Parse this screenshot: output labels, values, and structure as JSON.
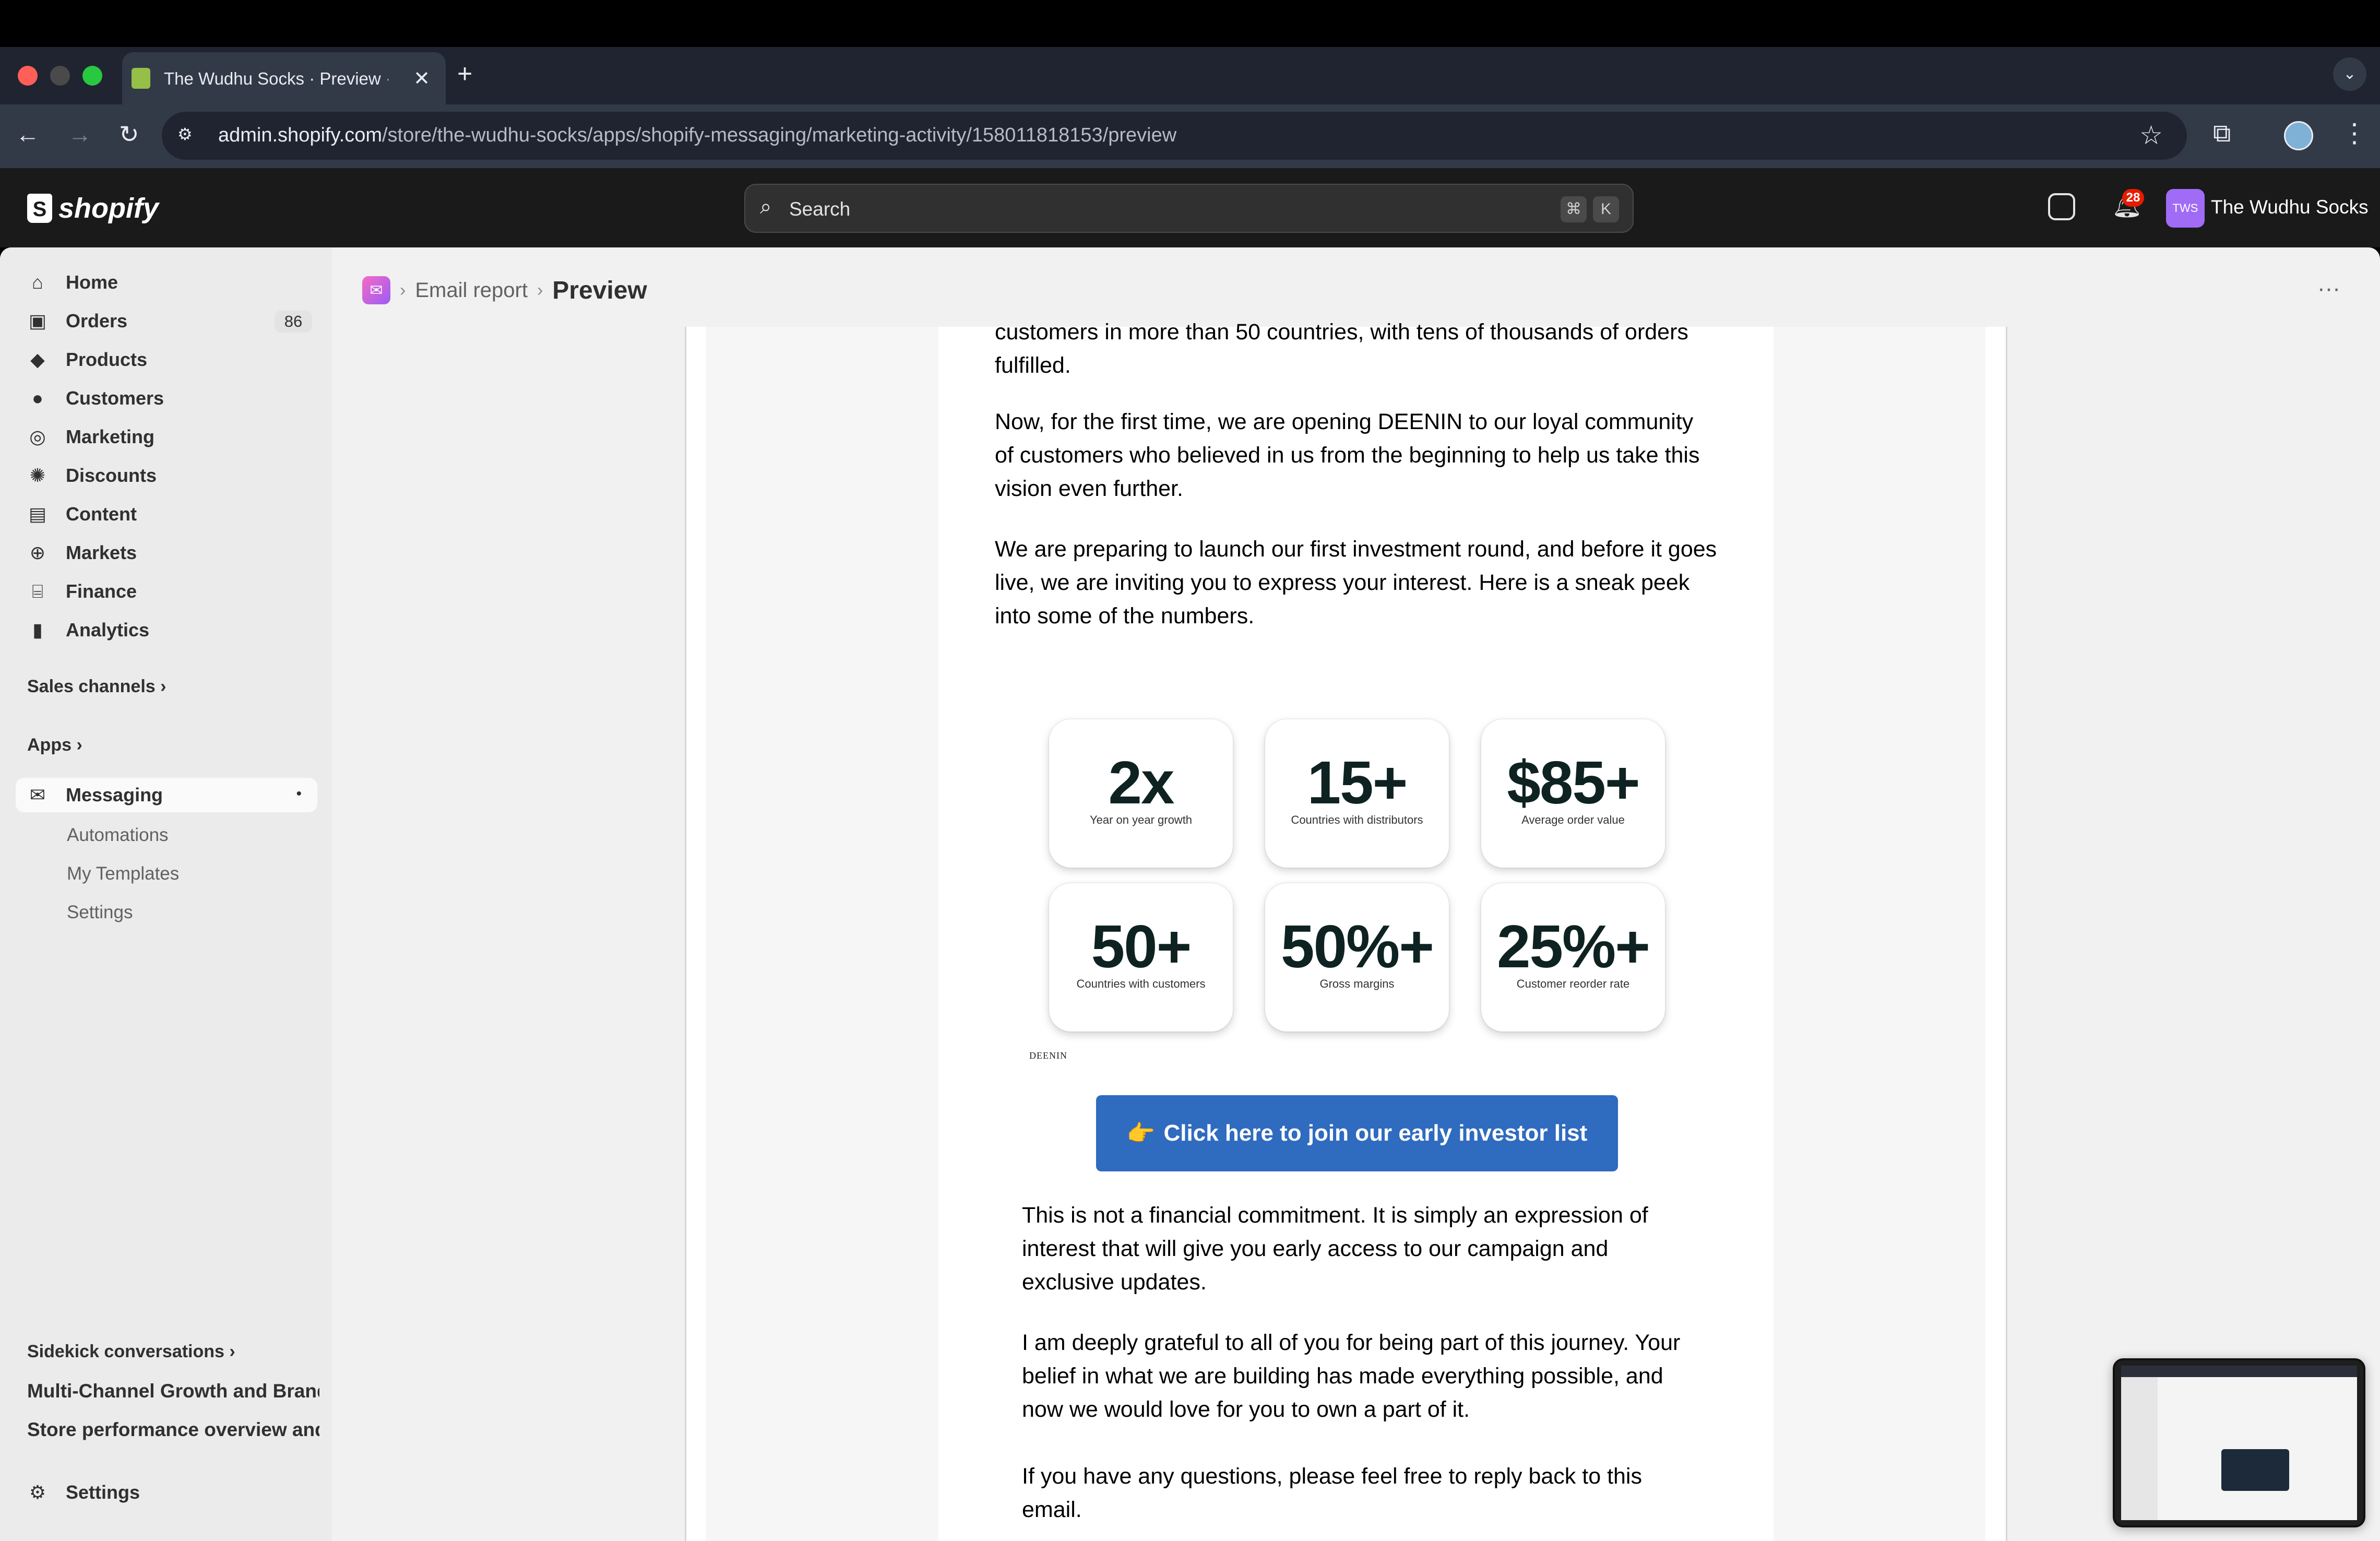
{
  "browser": {
    "tab_title": "The Wudhu Socks · Preview · Shopify",
    "tab_close": "✕",
    "new_tab": "+",
    "url_host": "admin.shopify.com",
    "url_path": "/store/the-wudhu-socks/apps/shopify-messaging/marketing-activity/158011818153/preview",
    "traffic_colors": [
      "#ff5f57",
      "#4a4a4a",
      "#28c840"
    ]
  },
  "topbar": {
    "logo_text": "shopify",
    "search_placeholder": "Search",
    "shortcut_keys": [
      "⌘",
      "K"
    ],
    "notifications_count": "28",
    "store_initials": "TWS",
    "store_name": "The Wudhu Socks"
  },
  "sidebar": {
    "items": [
      {
        "label": "Home",
        "icon": "home-icon"
      },
      {
        "label": "Orders",
        "icon": "orders-icon",
        "badge": "86"
      },
      {
        "label": "Products",
        "icon": "tag-icon"
      },
      {
        "label": "Customers",
        "icon": "person-icon"
      },
      {
        "label": "Marketing",
        "icon": "target-icon"
      },
      {
        "label": "Discounts",
        "icon": "discount-icon"
      },
      {
        "label": "Content",
        "icon": "content-icon"
      },
      {
        "label": "Markets",
        "icon": "globe-icon"
      },
      {
        "label": "Finance",
        "icon": "bank-icon"
      },
      {
        "label": "Analytics",
        "icon": "bar-chart-icon"
      }
    ],
    "sales_channels": "Sales channels",
    "apps": "Apps",
    "messaging": "Messaging",
    "messaging_sub": [
      "Automations",
      "My Templates",
      "Settings"
    ],
    "sidekick_heading": "Sidekick conversations",
    "conversations": [
      "Multi-Channel Growth and Brand Strategy",
      "Store performance overview and analysis"
    ],
    "settings": "Settings"
  },
  "header": {
    "crumb": "Email report",
    "current": "Preview"
  },
  "email": {
    "p0_line1": "customers in more than 50 countries, with tens of thousands of orders",
    "p0_line2": "fulfilled.",
    "p1_line1": "Now, for the first time, we are opening DEENIN to our loyal community",
    "p1_line2": "of customers who believed in us from the beginning to help us take this",
    "p1_line3": "vision even further.",
    "p2_line1": "We are preparing to launch our first investment round, and before it goes",
    "p2_line2": "live, we are inviting you to express your interest. Here is a sneak peek",
    "p2_line3": "into some of the numbers.",
    "stats": [
      {
        "value": "2x",
        "caption": "Year on year growth"
      },
      {
        "value": "15+",
        "caption": "Countries with distributors"
      },
      {
        "value": "$85+",
        "caption": "Average order value"
      },
      {
        "value": "50+",
        "caption": "Countries with customers"
      },
      {
        "value": "50%+",
        "caption": "Gross margins"
      },
      {
        "value": "25%+",
        "caption": "Customer reorder rate"
      }
    ],
    "brand_mark": "DEENIN",
    "cta_emoji": "👉",
    "cta_label": "Click here to join our early investor list",
    "p3_line1": "This is not a financial commitment. It is simply an expression of",
    "p3_line2": "interest that will give you early access to our campaign and",
    "p3_line3": "exclusive updates.",
    "p4_line1": "I am deeply grateful to all of you for being part of this journey. Your",
    "p4_line2": "belief in what we are building has made everything possible, and",
    "p4_line3": "now we would love for you to own a part of it.",
    "p5_line1": "If you have any questions, please feel free to reply back to this",
    "p5_line2": "email."
  },
  "colors": {
    "cta": "#2f6bbf",
    "shopify_bar": "#1a1a1a",
    "sidebar_bg": "#ebebeb"
  }
}
